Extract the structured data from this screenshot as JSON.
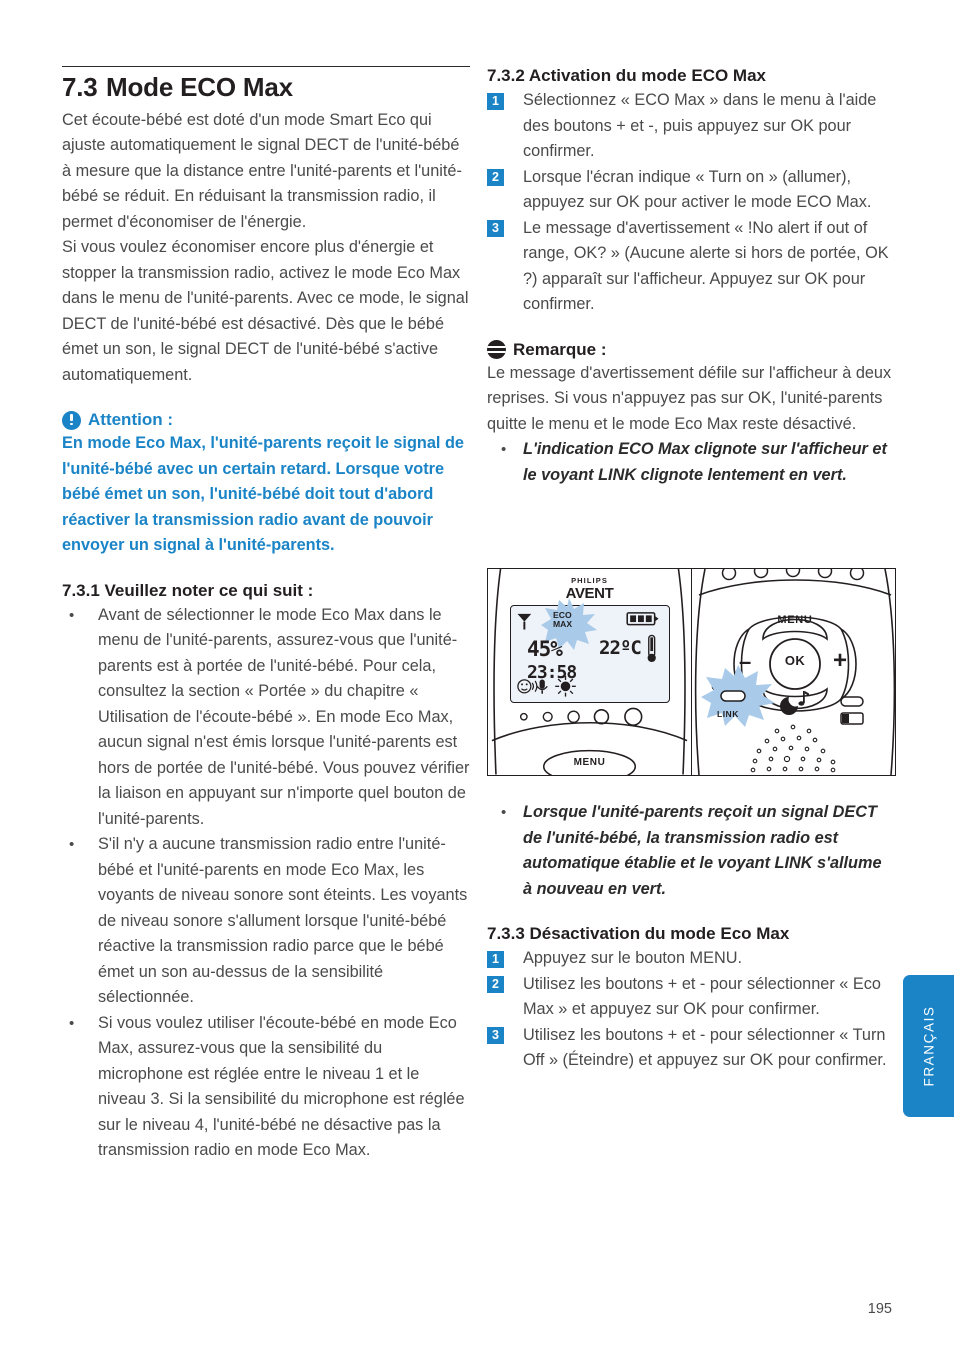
{
  "chapter": {
    "number": "7.3",
    "title": "Mode ECO Max",
    "intro_paragraphs": [
      "Cet écoute-bébé est doté d'un mode Smart Eco qui ajuste automatiquement le signal DECT de l'unité-bébé à mesure que la distance entre l'unité-parents et l'unité-bébé se réduit. En réduisant la transmission radio, il permet d'économiser de l'énergie.",
      "Si vous voulez économiser encore plus d'énergie et stopper la transmission radio, activez le mode Eco Max dans le menu de l'unité-parents. Avec ce mode, le signal DECT de l'unité-bébé est désactivé. Dès que le bébé émet un son, le signal DECT de l'unité-bébé s'active automatiquement."
    ]
  },
  "attention": {
    "icon": "exclamation-circle-icon",
    "title": "Attention :",
    "text": "En mode Eco Max, l'unité-parents reçoit le signal de l'unité-bébé avec un certain retard. Lorsque votre bébé émet un son, l'unité-bébé doit tout d'abord réactiver la transmission radio avant de pouvoir envoyer un signal à l'unité-parents."
  },
  "section_731": {
    "heading": "7.3.1 Veuillez noter ce qui suit :",
    "bullets": [
      "Avant de sélectionner le mode Eco Max dans le menu de l'unité-parents, assurez-vous que l'unité-parents est à portée de l'unité-bébé. Pour cela, consultez la section « Portée » du chapitre « Utilisation de l'écoute-bébé ». En mode Eco Max, aucun signal n'est émis lorsque l'unité-parents est hors de portée de l'unité-bébé. Vous pouvez vérifier la liaison en appuyant sur n'importe quel bouton de l'unité-parents.",
      "S'il n'y a aucune transmission radio entre l'unité-bébé et l'unité-parents en mode Eco Max, les voyants de niveau sonore sont éteints. Les voyants de niveau sonore s'allument lorsque l'unité-bébé réactive la transmission radio parce que le bébé émet un son au-dessus de la sensibilité sélectionnée.",
      "Si vous voulez utiliser l'écoute-bébé en mode Eco Max, assurez-vous que la sensibilité du microphone est réglée entre le niveau 1 et le niveau 3. Si la sensibilité du microphone est réglée sur le niveau 4, l'unité-bébé ne désactive pas la transmission radio en mode Eco Max."
    ]
  },
  "section_732": {
    "heading": "7.3.2 Activation du mode ECO Max",
    "steps": [
      {
        "num": "1",
        "text": "Sélectionnez « ECO Max » dans le menu à l'aide des boutons + et -, puis appuyez sur OK pour confirmer."
      },
      {
        "num": "2",
        "text": "Lorsque l'écran indique « Turn on » (allumer), appuyez sur OK pour activer le mode ECO Max."
      },
      {
        "num": "3",
        "text": "Le message d'avertissement « !No alert if out of range, OK? » (Aucune alerte si hors de portée, OK ?) apparaît sur l'afficheur. Appuyez sur OK pour confirmer."
      }
    ]
  },
  "remarque": {
    "icon": "note-circle-icon",
    "title": "Remarque :",
    "text": "Le message d'avertissement défile sur l'afficheur à deux reprises. Si vous n'appuyez pas sur OK, l'unité-parents quitte le menu et le mode Eco Max reste désactivé.",
    "bullets": [
      "L'indication ECO Max clignote sur l'afficheur et le voyant LINK clignote lentement en vert."
    ]
  },
  "figure": {
    "brand_top": "PHILIPS",
    "brand_main": "AVENT",
    "lcd": {
      "eco_label_line1": "ECO",
      "eco_label_line2": "MAX",
      "humidity": "45%",
      "temperature": "22ºC",
      "clock": "23:58",
      "antenna_icon": "antenna-icon",
      "sun_icon": "sun-icon",
      "battery_icon": "battery-icon",
      "thermometer_icon": "thermometer-icon",
      "smiley_icon": "smiley-sound-icon",
      "mic_icon": "microphone-icon",
      "nightlight_icon": "nightlight-icon"
    },
    "left_menu_label": "MENU",
    "buttons": {
      "menu": "MENU",
      "ok": "OK",
      "minus": "–",
      "plus": "+",
      "lullaby_icon": "moon-music-icon"
    },
    "link_label": "LINK"
  },
  "figure_note_bullets": [
    "Lorsque l'unité-parents reçoit un signal DECT de l'unité-bébé, la transmission radio est automatique établie et le voyant LINK s'allume à nouveau en vert."
  ],
  "section_733": {
    "heading": "7.3.3 Désactivation du mode Eco Max",
    "steps": [
      {
        "num": "1",
        "text": "Appuyez sur le bouton MENU."
      },
      {
        "num": "2",
        "text": " Utilisez les boutons + et - pour sélectionner « Eco Max » et appuyez sur OK pour confirmer."
      },
      {
        "num": "3",
        "text": " Utilisez les boutons + et - pour sélectionner « Turn Off » (Éteindre) et appuyez sur OK pour confirmer."
      }
    ]
  },
  "language_tab": "FRANÇAIS",
  "page_number": "195",
  "colors": {
    "accent_blue": "#1a84c7",
    "text_gray": "#4a4a4a",
    "heading_black": "#231f20",
    "lcd_background": "#eef3f9",
    "burst_blue": "#a9cbe9"
  }
}
